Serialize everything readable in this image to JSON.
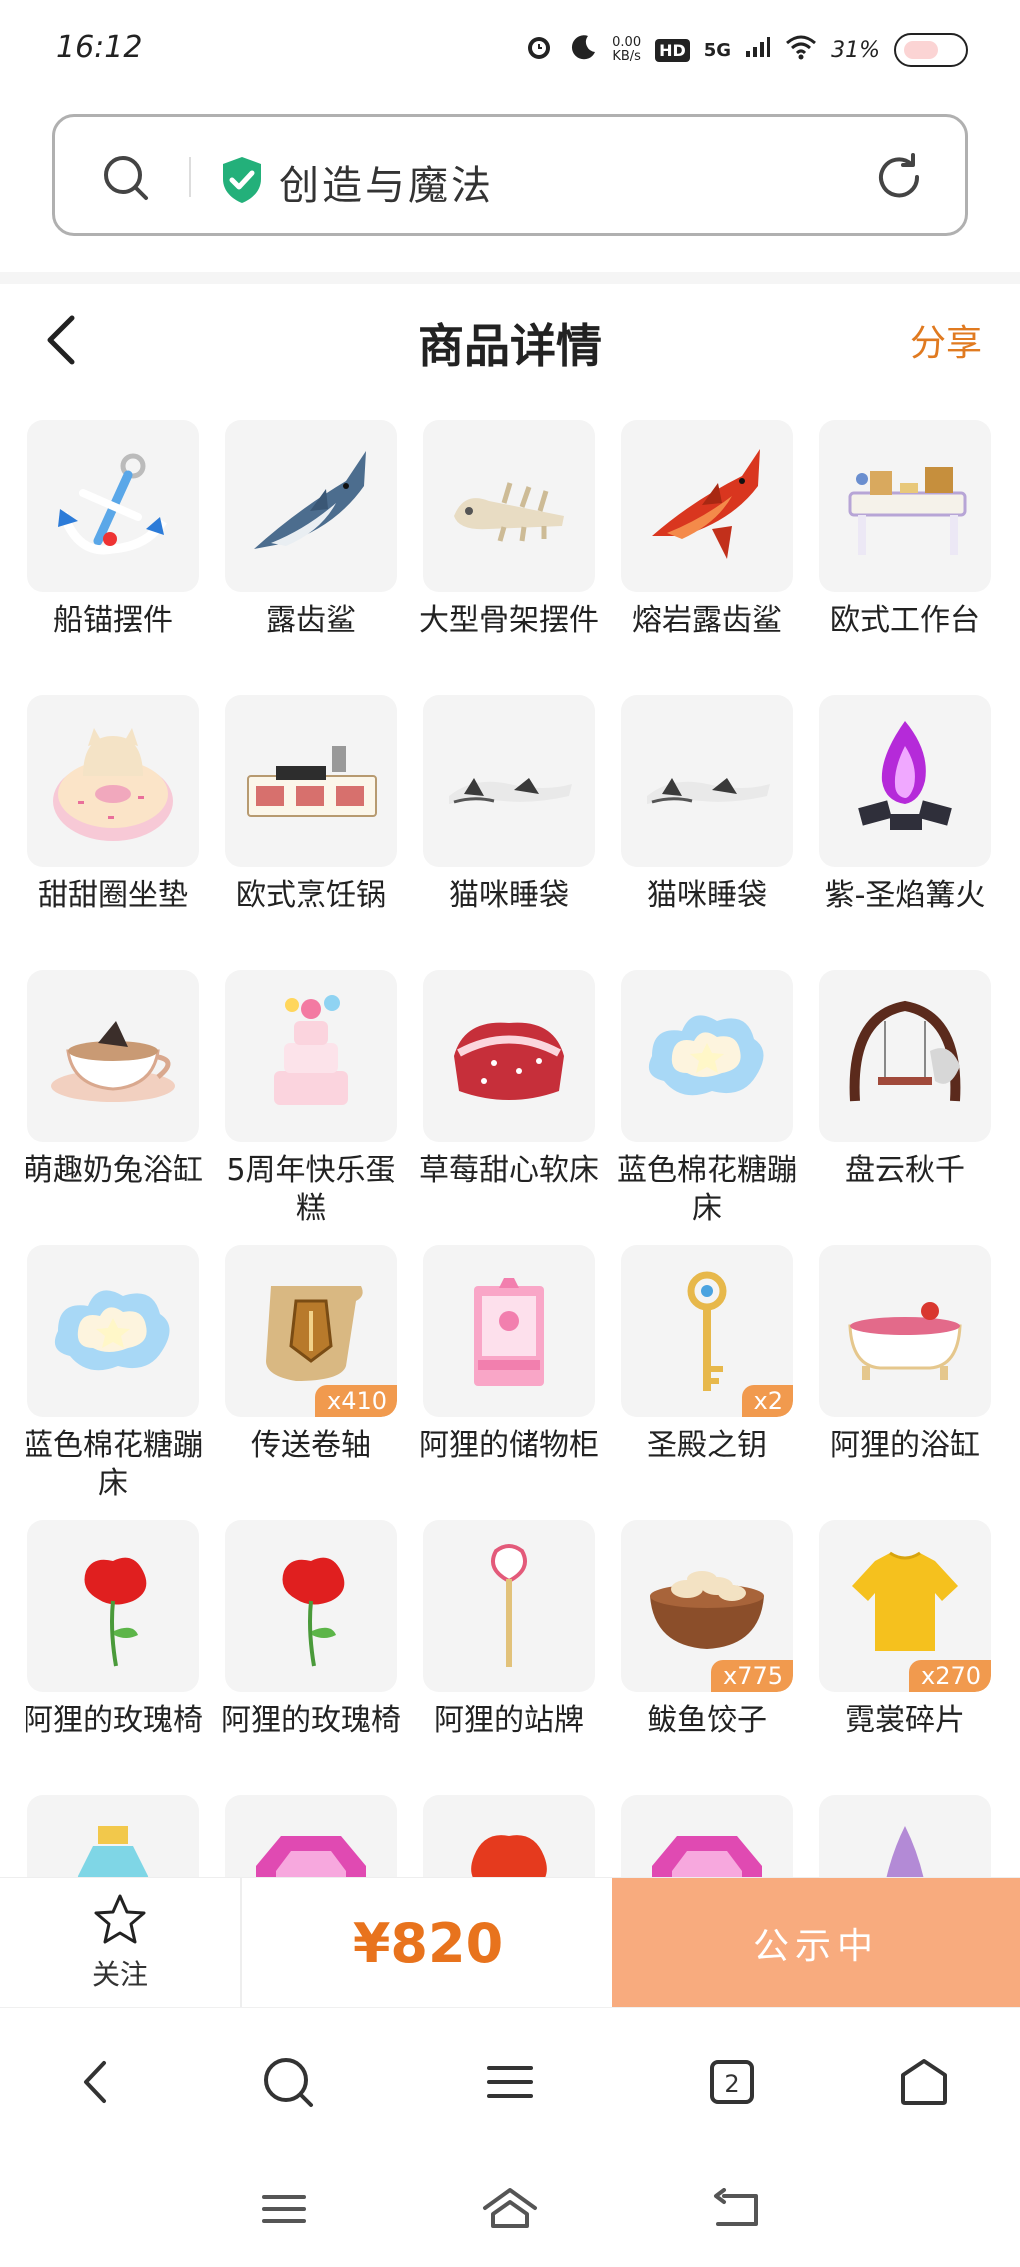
{
  "status_bar": {
    "time": "16:12",
    "net_speed": "0.00",
    "net_unit": "KB/s",
    "hd": "HD",
    "network": "5G",
    "battery": "31%"
  },
  "address_bar": {
    "text": "创造与魔法"
  },
  "header": {
    "title": "商品详情",
    "share": "分享"
  },
  "items": [
    {
      "name": "船锚摆件",
      "icon": "anchor"
    },
    {
      "name": "露齿鲨",
      "icon": "shark-blue"
    },
    {
      "name": "大型骨架摆件",
      "icon": "skeleton"
    },
    {
      "name": "熔岩露齿鲨",
      "icon": "shark-red"
    },
    {
      "name": "欧式工作台",
      "icon": "desk"
    },
    {
      "name": "甜甜圈坐垫",
      "icon": "donut"
    },
    {
      "name": "欧式烹饪锅",
      "icon": "stove"
    },
    {
      "name": "猫咪睡袋",
      "icon": "cat-sleeping-bag"
    },
    {
      "name": "猫咪睡袋",
      "icon": "cat-sleeping-bag"
    },
    {
      "name": "紫-圣焰篝火",
      "icon": "purple-bonfire"
    },
    {
      "name": "萌趣奶兔浴缸",
      "icon": "teacup-tub"
    },
    {
      "name": "5周年快乐蛋糕",
      "icon": "cake"
    },
    {
      "name": "草莓甜心软床",
      "icon": "strawberry-bed"
    },
    {
      "name": "蓝色棉花糖蹦床",
      "icon": "cloud-trampoline"
    },
    {
      "name": "盘云秋千",
      "icon": "swing"
    },
    {
      "name": "蓝色棉花糖蹦床",
      "icon": "cloud-trampoline"
    },
    {
      "name": "传送卷轴",
      "icon": "scroll",
      "qty": "x410"
    },
    {
      "name": "阿狸的储物柜",
      "icon": "pink-cabinet"
    },
    {
      "name": "圣殿之钥",
      "icon": "golden-key",
      "qty": "x2"
    },
    {
      "name": "阿狸的浴缸",
      "icon": "bathtub"
    },
    {
      "name": "阿狸的玫瑰椅",
      "icon": "rose"
    },
    {
      "name": "阿狸的玫瑰椅",
      "icon": "rose"
    },
    {
      "name": "阿狸的站牌",
      "icon": "sign"
    },
    {
      "name": "鲅鱼饺子",
      "icon": "dumplings",
      "qty": "x775"
    },
    {
      "name": "霓裳碎片",
      "icon": "shirt",
      "qty": "x270"
    },
    {
      "name": "",
      "icon": "potion"
    },
    {
      "name": "",
      "icon": "gem-pink"
    },
    {
      "name": "",
      "icon": "red-flower"
    },
    {
      "name": "",
      "icon": "gem-pink"
    },
    {
      "name": "",
      "icon": "purple-cone"
    }
  ],
  "action_bar": {
    "follow": "关注",
    "price": "¥820",
    "status": "公示中"
  },
  "colors": {
    "accent": "#e8731d",
    "status_button": "#f8ab7e",
    "badge": "#f19a4e"
  }
}
